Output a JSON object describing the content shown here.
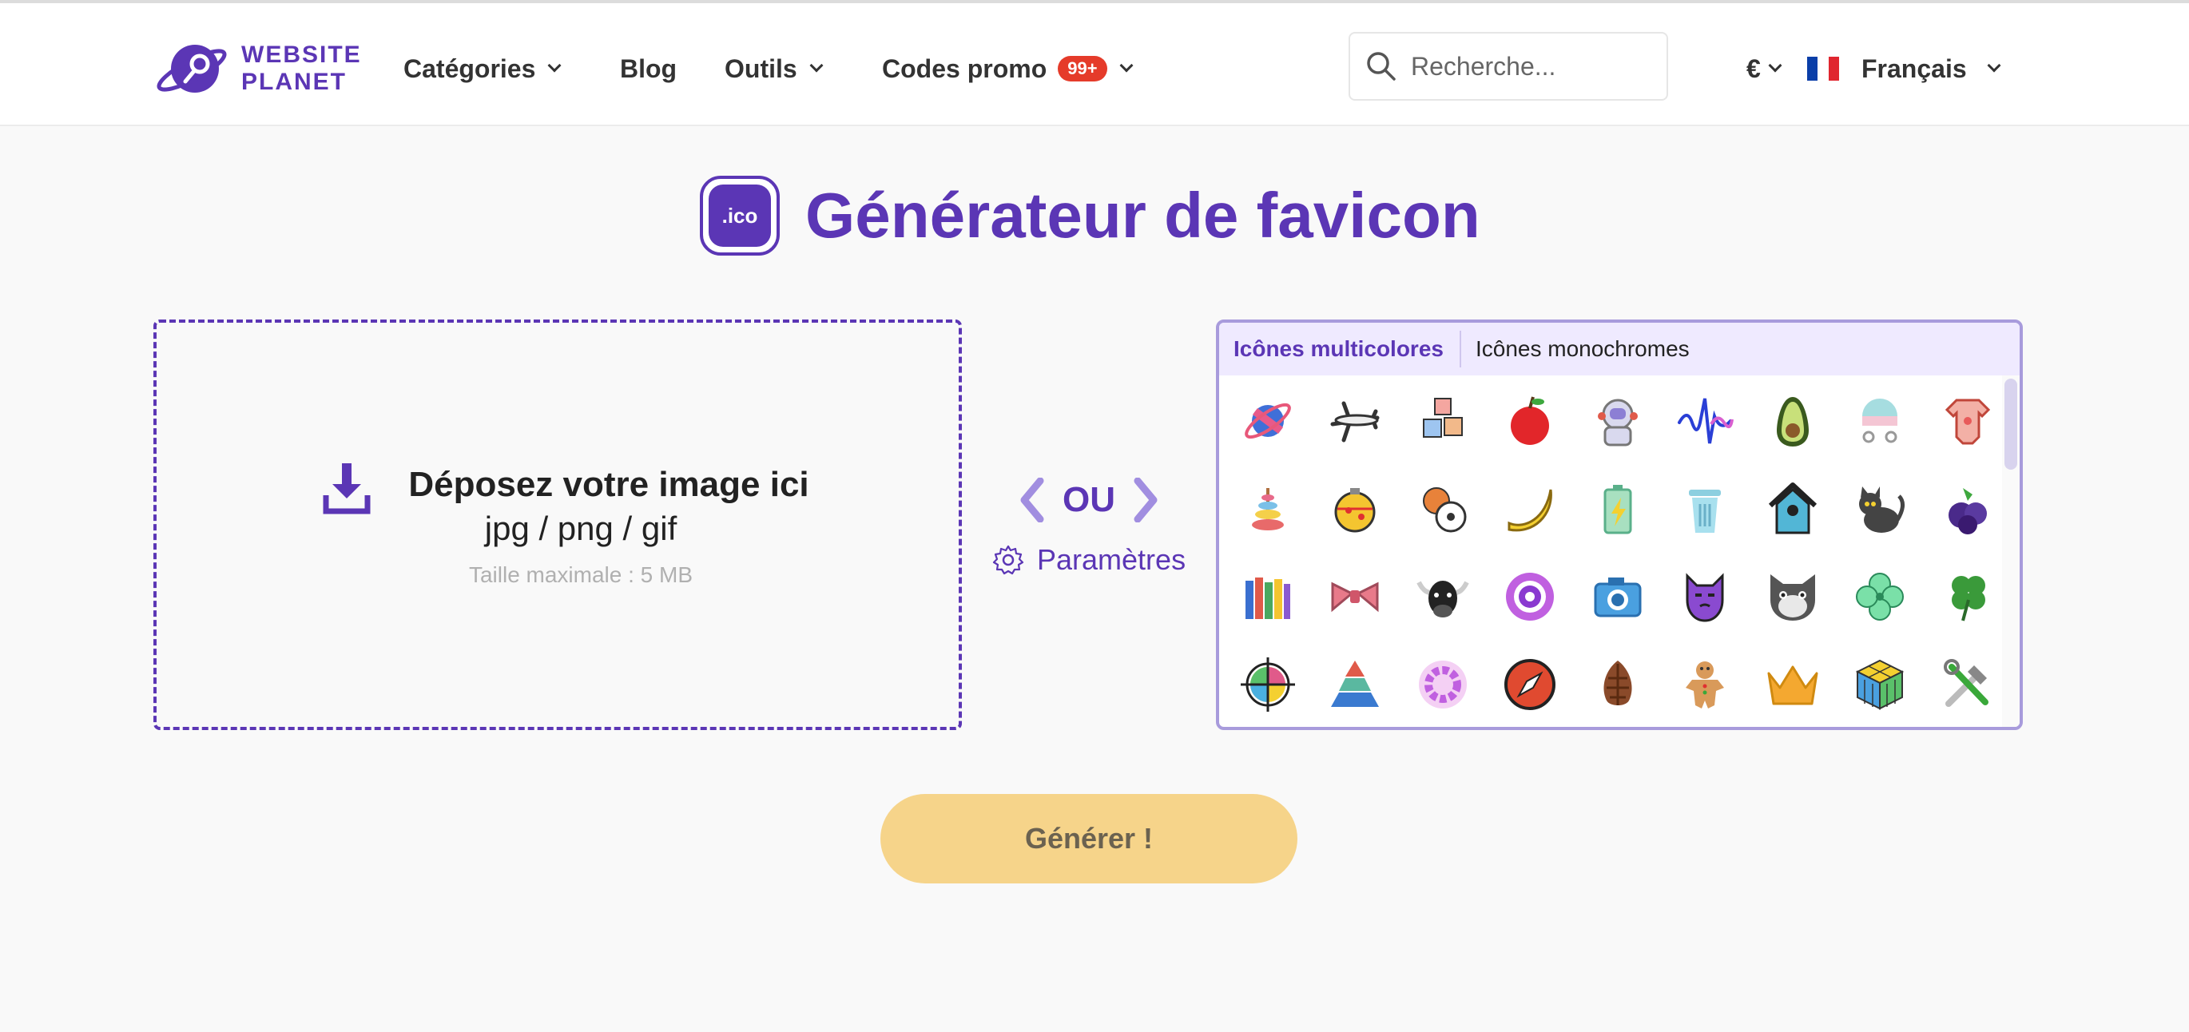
{
  "header": {
    "logo_line1": "WEBSITE",
    "logo_line2": "PLANET",
    "nav": {
      "categories": "Catégories",
      "blog": "Blog",
      "tools": "Outils",
      "promo": "Codes promo",
      "promo_badge": "99+"
    },
    "search_placeholder": "Recherche...",
    "currency": "€",
    "language": "Français"
  },
  "main": {
    "ico_badge": ".ico",
    "title": "Générateur de favicon",
    "dropzone": {
      "title": "Déposez votre image ici",
      "formats": "jpg / png / gif",
      "max_size": "Taille maximale : 5 MB"
    },
    "or_label": "OU",
    "settings_label": "Paramètres",
    "tabs": {
      "multicolor": "Icônes multicolores",
      "monochrome": "Icônes monochromes"
    },
    "icons": [
      "planet-icon",
      "airplane-icon",
      "abc-blocks-icon",
      "apple-icon",
      "astronaut-icon",
      "sound-wave-icon",
      "avocado-icon",
      "baby-stroller-icon",
      "baby-bodysuit-icon",
      "ring-stack-toy-icon",
      "christmas-ornament-icon",
      "sport-balls-icon",
      "banana-icon",
      "battery-icon",
      "trash-bin-icon",
      "birdhouse-icon",
      "black-cat-icon",
      "blueberries-icon",
      "books-icon",
      "bow-tie-icon",
      "bull-icon",
      "camera-lens-icon",
      "camera-icon",
      "purple-cat-icon",
      "gray-cat-icon",
      "green-clover-icon",
      "four-leaf-clover-icon",
      "color-target-icon",
      "pyramid-chart-icon",
      "color-wheel-icon",
      "compass-icon",
      "pine-cone-icon",
      "gingerbread-man-icon",
      "crown-icon",
      "rubiks-cube-icon",
      "tools-icon"
    ],
    "generate_button": "Générer !"
  },
  "colors": {
    "brand_purple": "#5b36b5",
    "promo_red": "#e53b2a",
    "button_yellow": "#f6d48a",
    "panel_border": "#a89bdc"
  }
}
